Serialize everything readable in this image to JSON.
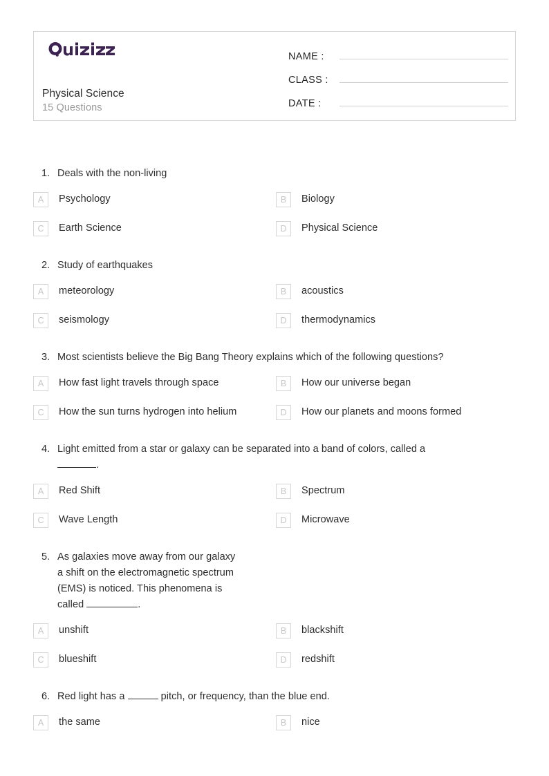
{
  "brand": {
    "logo_text": "Quizizz",
    "logo_color": "#3D2352"
  },
  "header": {
    "quiz_title": "Physical Science",
    "question_count_label": "15 Questions",
    "fields": [
      {
        "label": "NAME :",
        "value": ""
      },
      {
        "label": "CLASS :",
        "value": ""
      },
      {
        "label": "DATE  :",
        "value": ""
      }
    ]
  },
  "questions": [
    {
      "number": "1.",
      "lines": [
        "Deals with the non-living"
      ],
      "options": [
        {
          "letter": "A",
          "text": "Psychology"
        },
        {
          "letter": "B",
          "text": "Biology"
        },
        {
          "letter": "C",
          "text": "Earth Science"
        },
        {
          "letter": "D",
          "text": "Physical Science"
        }
      ]
    },
    {
      "number": "2.",
      "lines": [
        "Study of earthquakes"
      ],
      "options": [
        {
          "letter": "A",
          "text": "meteorology"
        },
        {
          "letter": "B",
          "text": "acoustics"
        },
        {
          "letter": "C",
          "text": "seismology"
        },
        {
          "letter": "D",
          "text": "thermodynamics"
        }
      ]
    },
    {
      "number": "3.",
      "lines": [
        "Most scientists believe the Big Bang Theory explains which of the following questions?"
      ],
      "options": [
        {
          "letter": "A",
          "text": "How fast light travels through space"
        },
        {
          "letter": "B",
          "text": "How our universe began"
        },
        {
          "letter": "C",
          "text": "How the sun turns hydrogen into helium"
        },
        {
          "letter": "D",
          "text": "How our planets and moons formed"
        }
      ]
    },
    {
      "number": "4.",
      "lines": [
        "Light emitted from a star or galaxy can be separated into a band of colors, called a"
      ],
      "blank_line_suffix": ".",
      "options": [
        {
          "letter": "A",
          "text": "Red Shift"
        },
        {
          "letter": "B",
          "text": "Spectrum"
        },
        {
          "letter": "C",
          "text": "Wave Length"
        },
        {
          "letter": "D",
          "text": "Microwave"
        }
      ]
    },
    {
      "number": "5.",
      "lines": [
        "As galaxies move away from our galaxy",
        "a shift on the electromagnetic spectrum",
        "(EMS) is noticed. This phenomena is"
      ],
      "last_line_prefix": "called ",
      "last_line_suffix": ".",
      "options": [
        {
          "letter": "A",
          "text": "unshift"
        },
        {
          "letter": "B",
          "text": "blackshift"
        },
        {
          "letter": "C",
          "text": "blueshift"
        },
        {
          "letter": "D",
          "text": "redshift"
        }
      ]
    },
    {
      "number": "6.",
      "line_prefix": "Red light has a ",
      "line_suffix": " pitch, or frequency, than the blue end.",
      "options": [
        {
          "letter": "A",
          "text": "the same"
        },
        {
          "letter": "B",
          "text": "nice"
        }
      ]
    }
  ]
}
